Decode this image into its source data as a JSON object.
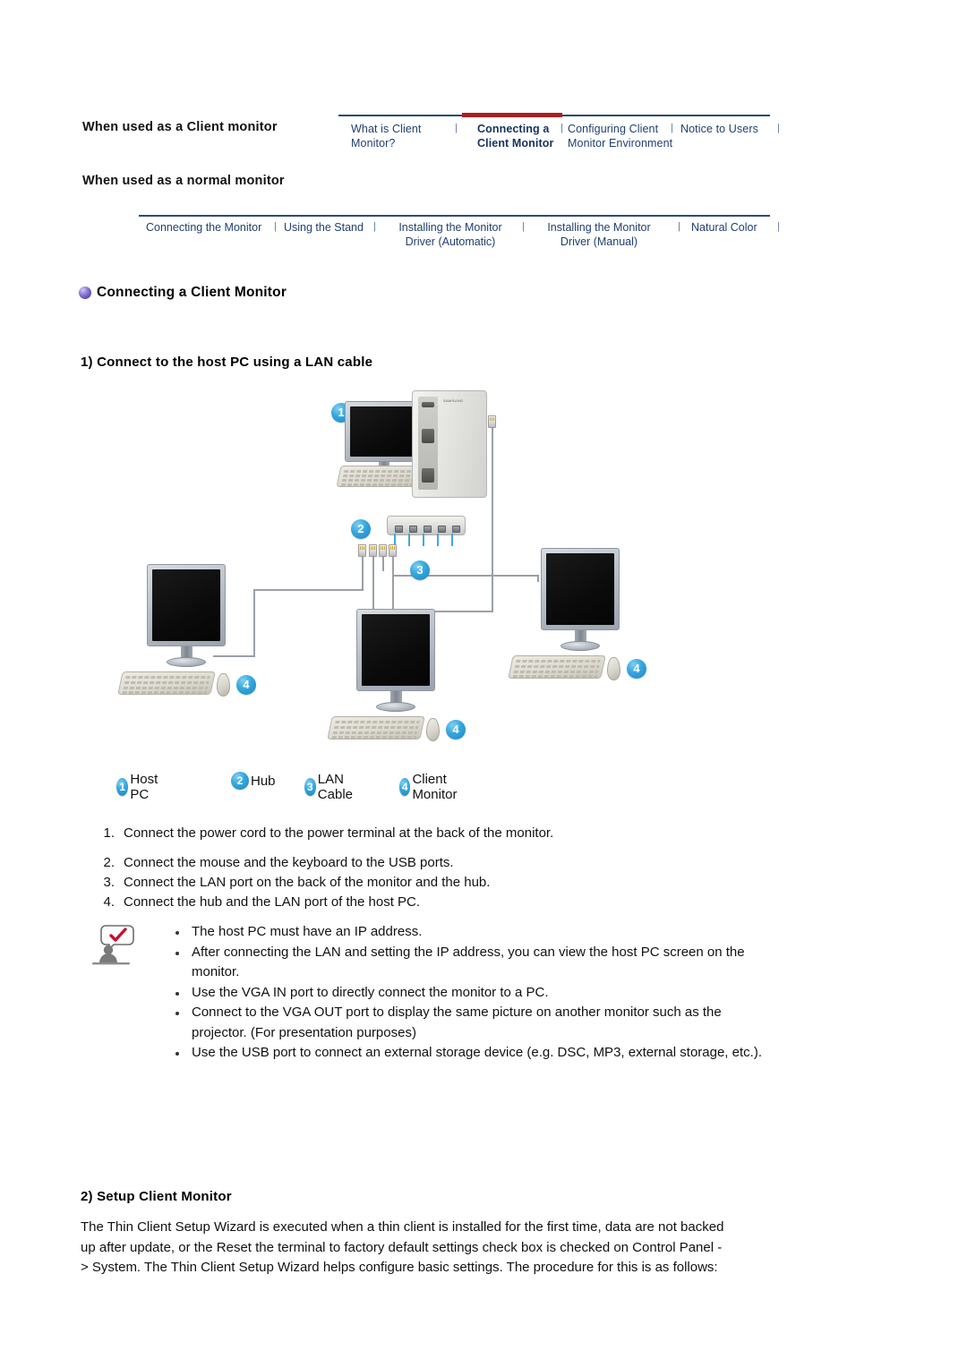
{
  "nav": {
    "side_labels": [
      "When used as a\nClient monitor",
      "When used as a\nnormal monitor"
    ],
    "client_tabs": [
      {
        "label": "What is Client\nMonitor?",
        "active": false
      },
      {
        "label": "Connecting a\nClient Monitor",
        "active": true
      },
      {
        "label": "Configuring  Client\nMonitor  Environment",
        "active": false
      },
      {
        "label": "Notice to Users",
        "active": false
      }
    ],
    "normal_tabs": [
      {
        "label": "Connecting  the Monitor"
      },
      {
        "label": "Using the Stand"
      },
      {
        "label": "Installing the Monitor Driver\n(Automatic)"
      },
      {
        "label": "Installing the Monitor Driver\n(Manual)"
      },
      {
        "label": "Natural Color"
      }
    ],
    "separator": "|",
    "active_color": "#a81f22",
    "link_color": "#1f3f70",
    "rule_color": "#2b4a73"
  },
  "section": {
    "title": "Connecting a Client Monitor",
    "bullet_icon": "purple-sphere-bullet",
    "subtitle": "1) Connect to the host PC using a LAN cable"
  },
  "diagram": {
    "callouts": [
      {
        "n": "1",
        "name": "host-pc"
      },
      {
        "n": "2",
        "name": "hub"
      },
      {
        "n": "3",
        "name": "lan-cable"
      },
      {
        "n": "4",
        "name": "client-monitor-left"
      },
      {
        "n": "4",
        "name": "client-monitor-center"
      },
      {
        "n": "4",
        "name": "client-monitor-right"
      }
    ],
    "badge_color": "#1b86c4"
  },
  "legend": [
    {
      "n": "1",
      "label": "Host PC"
    },
    {
      "n": "2",
      "label": "Hub"
    },
    {
      "n": "3",
      "label": "LAN Cable"
    },
    {
      "n": "4",
      "label": "Client Monitor"
    }
  ],
  "steps": [
    {
      "num": "1.",
      "text": "Connect the power cord to the power terminal at the back of the monitor."
    },
    {
      "num": "2.",
      "text": "Connect the mouse and the keyboard to the USB ports."
    },
    {
      "num": "3.",
      "text": "Connect the LAN port on the back of the monitor and the hub."
    },
    {
      "num": "4.",
      "text": "Connect the hub and the LAN port of the host PC."
    }
  ],
  "note": {
    "icon": "person-with-checkmark-bubble-icon",
    "check_color": "#c8102e",
    "items": [
      "The host PC must have an IP address.",
      "After connecting the LAN and setting the IP address, you can view the host PC screen on the monitor.",
      "Use the VGA IN port to directly connect the monitor to a PC.",
      "Connect to the VGA OUT port to display the same picture on another monitor such as the projector. (For presentation purposes)",
      "Use the USB port to connect an external storage device (e.g. DSC, MP3, external storage, etc.)."
    ]
  },
  "bottom": {
    "title": "2) Setup Client Monitor",
    "paragraph": "The Thin Client Setup Wizard is executed when a thin client is installed for the first time, data are not backed up after update, or the Reset the terminal to factory default settings check box is checked on Control Panel -> System. The Thin Client Setup Wizard helps configure basic settings. The procedure for this is as follows:"
  }
}
